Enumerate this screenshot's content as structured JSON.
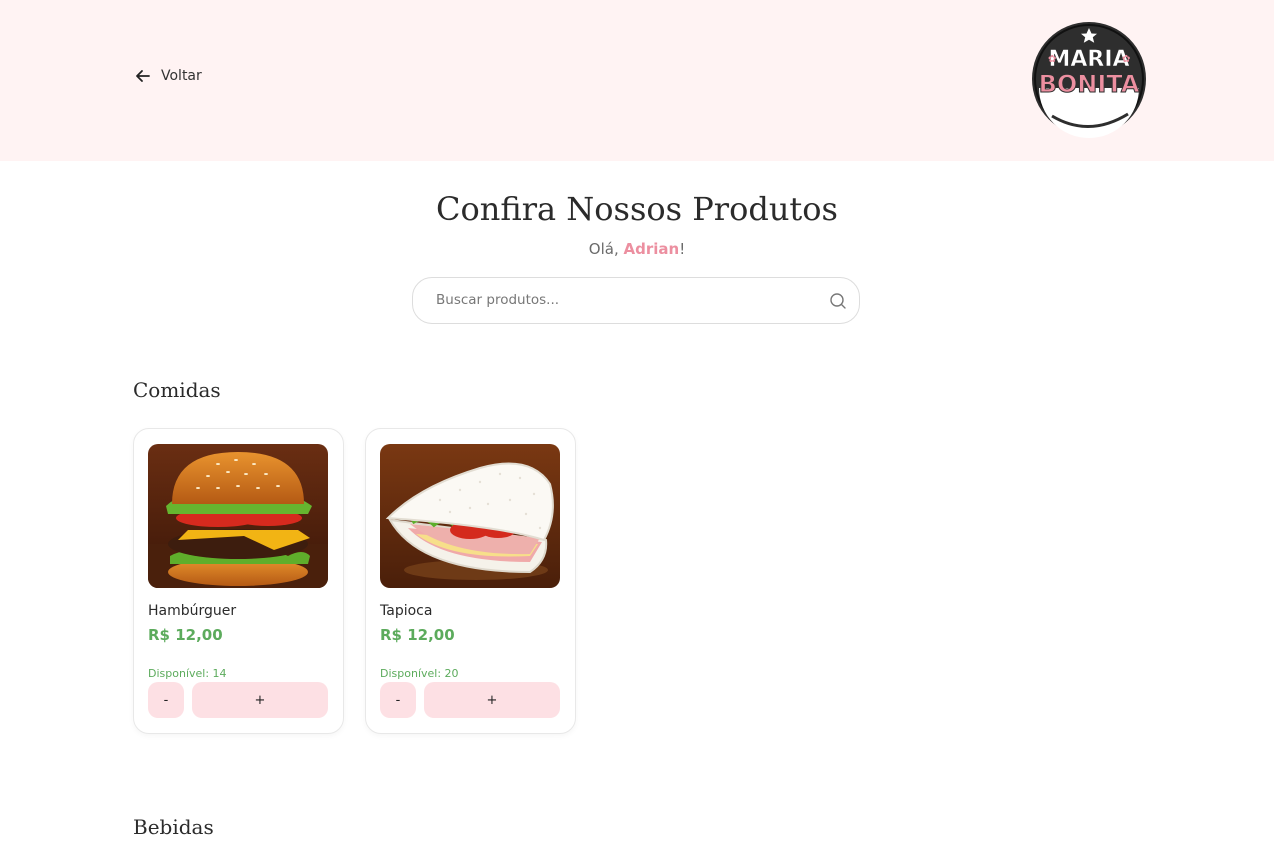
{
  "header": {
    "back_label": "Voltar",
    "logo": {
      "line1": "MARIA",
      "line2": "BONITA"
    }
  },
  "main": {
    "title": "Confira Nossos Produtos",
    "greeting_prefix": "Olá, ",
    "user_name": "Adrian",
    "greeting_suffix": "!"
  },
  "search": {
    "placeholder": "Buscar produtos..."
  },
  "sections": [
    {
      "title": "Comidas",
      "products": [
        {
          "name": "Hambúrguer",
          "price": "R$ 12,00",
          "available": "Disponível: 14",
          "minus_label": "-",
          "plus_label": "+",
          "image_icon": "hamburger-image"
        },
        {
          "name": "Tapioca",
          "price": "R$ 12,00",
          "available": "Disponível: 20",
          "minus_label": "-",
          "plus_label": "+",
          "image_icon": "tapioca-image"
        }
      ]
    },
    {
      "title": "Bebidas",
      "products": []
    }
  ],
  "colors": {
    "header_bg": "#fff3f3",
    "accent_pink": "#ec8fa0",
    "button_bg": "#fde0e4",
    "price_green": "#5cab5c"
  }
}
